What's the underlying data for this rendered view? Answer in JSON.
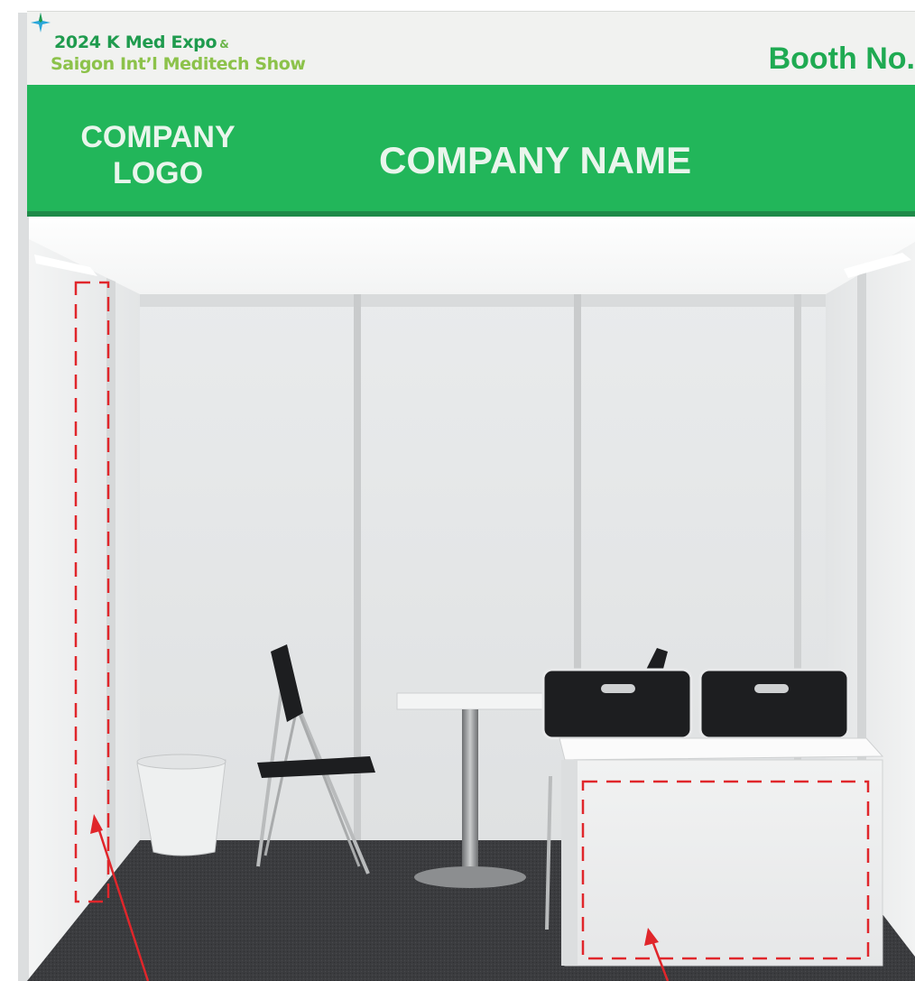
{
  "header": {
    "expo_line1": "2024 K Med Expo",
    "expo_ampersand": "&",
    "expo_line2": "Saigon Int’l Meditech Show",
    "booth_label": "Booth No."
  },
  "fascia": {
    "logo_placeholder": "COMPANY LOGO",
    "logo_line1": "COMPANY",
    "logo_line2": "LOGO",
    "name_placeholder": "COMPANY NAME"
  },
  "colors": {
    "fascia_green": "#22b65a",
    "expo_dark_green": "#1f9b4e",
    "expo_light_green": "#8cc24a",
    "annotation_red": "#e0262b",
    "carpet": "#3a3b3e"
  },
  "icons": {
    "expo_logo": "four-point-star-icon"
  }
}
